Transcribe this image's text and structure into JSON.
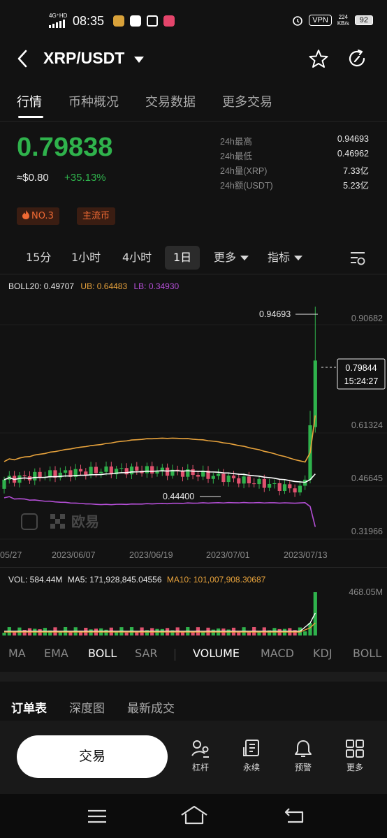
{
  "status_bar": {
    "network": "4G⁺HD",
    "time": "08:35",
    "vpn": "VPN",
    "speed_value": "224",
    "speed_unit": "KB/s",
    "battery": "92"
  },
  "header": {
    "pair": "XRP/USDT"
  },
  "tabs": [
    "行情",
    "币种概况",
    "交易数据",
    "更多交易"
  ],
  "ticker": {
    "price": "0.79838",
    "approx": "≈$0.80",
    "change": "+35.13%",
    "stats": [
      {
        "label": "24h最高",
        "value": "0.94693"
      },
      {
        "label": "24h最低",
        "value": "0.46962"
      },
      {
        "label": "24h量(XRP)",
        "value": "7.33亿"
      },
      {
        "label": "24h额(USDT)",
        "value": "5.23亿"
      }
    ],
    "badges": [
      "NO.3",
      "主流币"
    ]
  },
  "timeframes": {
    "items": [
      "15分",
      "1小时",
      "4小时",
      "1日"
    ],
    "active": "1日",
    "more": "更多",
    "indicator": "指标"
  },
  "chart": {
    "boll_label": "BOLL20: 0.49707",
    "ub_label": "UB: 0.64483",
    "lb_label": "LB: 0.34930",
    "y_ticks": [
      "0.90682",
      "0.61324",
      "0.46645",
      "0.31966"
    ],
    "x_ticks": [
      "05/27",
      "2023/06/07",
      "2023/06/19",
      "2023/07/01",
      "2023/07/13"
    ],
    "high_marker": "0.94693",
    "low_marker": "0.44400",
    "current_price": "0.79844",
    "countdown": "15:24:27",
    "watermark": "欧易",
    "colors": {
      "up": "#2fb24c",
      "down": "#e0526f",
      "mid": "#ffffff",
      "ub": "#e8a33c",
      "lb": "#b44fd6"
    }
  },
  "volume": {
    "vol_label": "VOL: 584.44M",
    "ma5_label": "MA5: 171,928,845.04556",
    "ma10_label": "MA10: 101,007,908.30687",
    "y_tick": "468.05M"
  },
  "indicators": [
    "MA",
    "EMA",
    "BOLL",
    "SAR",
    "VOLUME",
    "MACD",
    "KDJ",
    "BOLL"
  ],
  "book_tabs": [
    "订单表",
    "深度图",
    "最新成交"
  ],
  "bottom": {
    "trade": "交易",
    "actions": [
      {
        "label": "杠杆",
        "icon": "leverage-icon"
      },
      {
        "label": "永续",
        "icon": "perpetual-icon"
      },
      {
        "label": "预警",
        "icon": "bell-icon"
      },
      {
        "label": "更多",
        "icon": "grid-icon"
      }
    ]
  }
}
